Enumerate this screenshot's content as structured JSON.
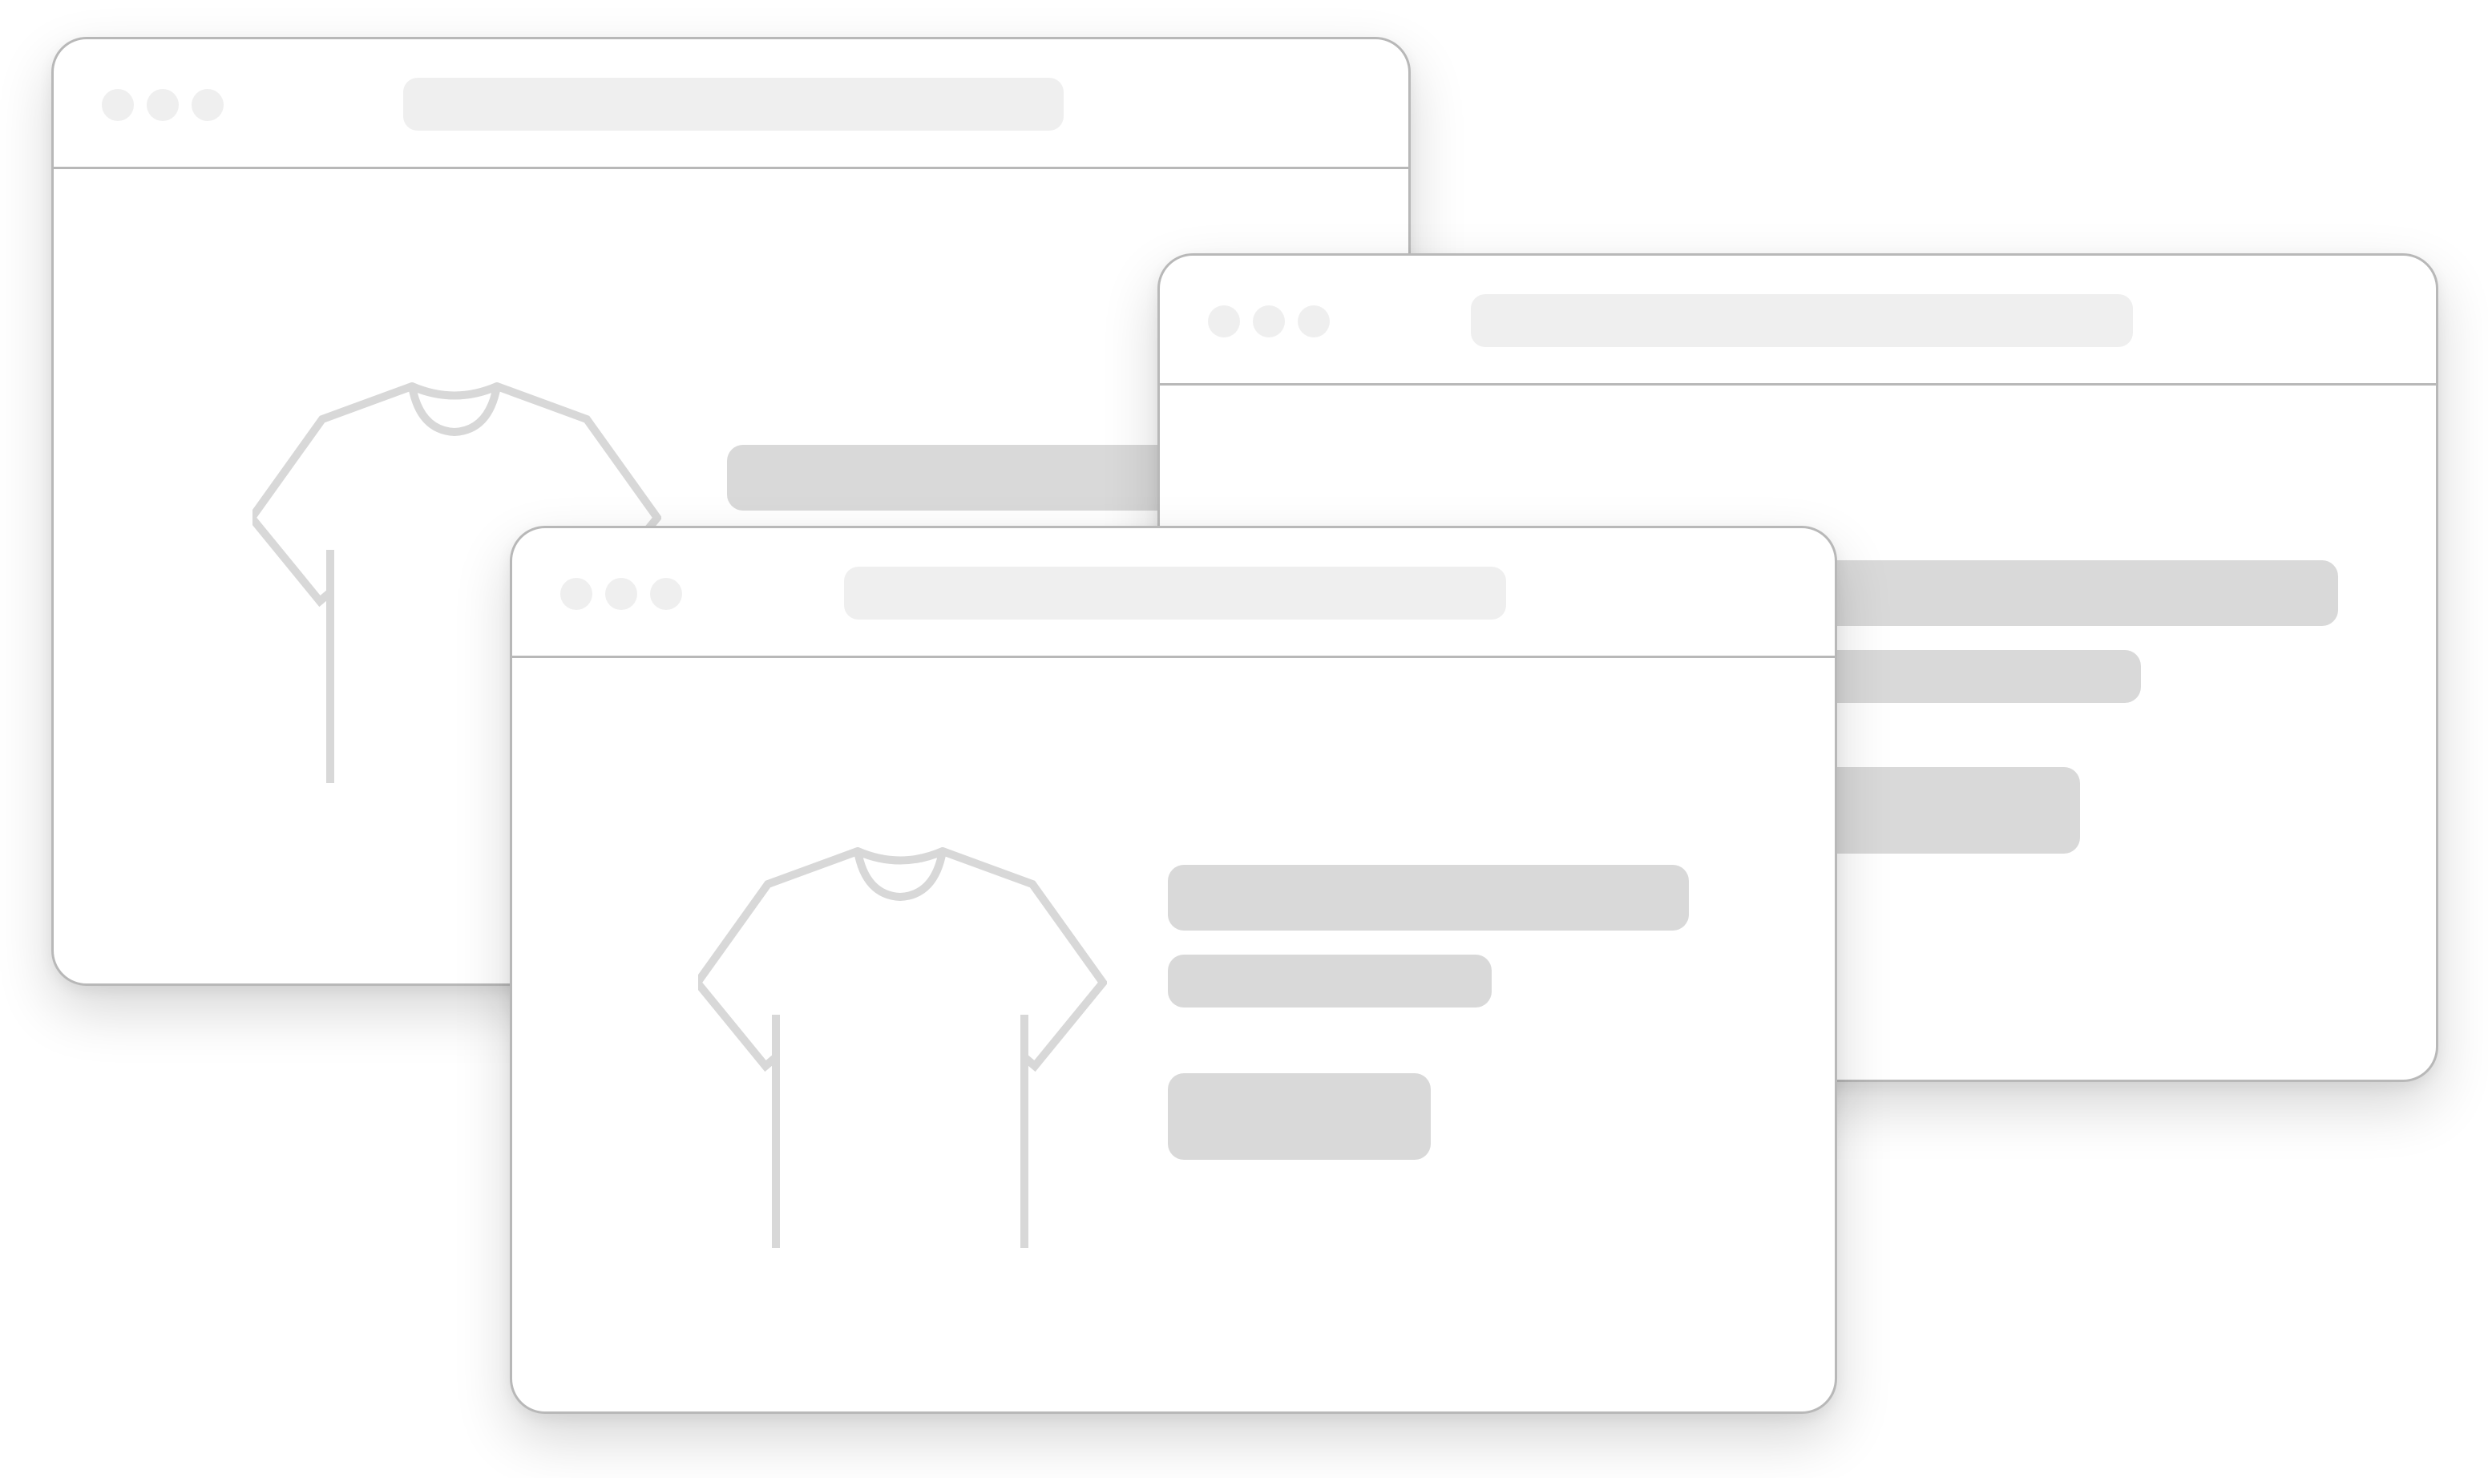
{
  "windows": [
    {
      "role": "back-left",
      "address_bar": {
        "text": ""
      },
      "product_icon": "tshirt-icon"
    },
    {
      "role": "back-right",
      "address_bar": {
        "text": ""
      },
      "product_icon": "tshirt-icon"
    },
    {
      "role": "front",
      "address_bar": {
        "text": ""
      },
      "product_icon": "tshirt-icon"
    }
  ],
  "colors": {
    "window_border": "#b8b8b8",
    "window_background": "#ffffff",
    "traffic_light": "#efefef",
    "address_bar": "#efefef",
    "skeleton": "#d9d9d9",
    "tshirt_outline": "#d8d8d8"
  }
}
